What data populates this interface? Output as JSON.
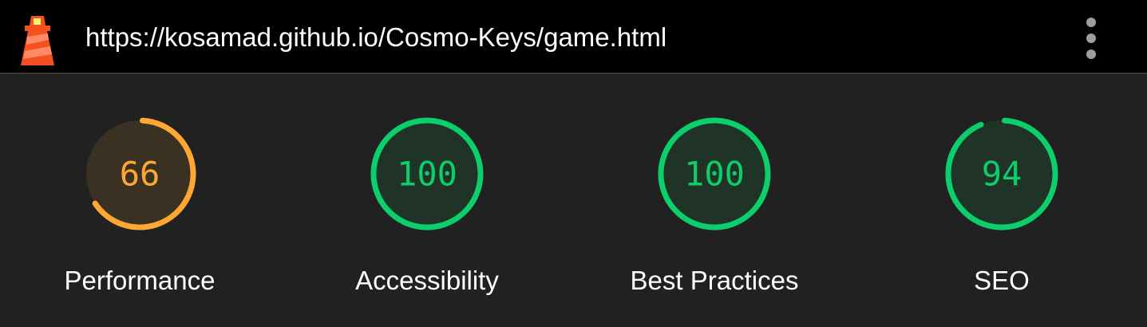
{
  "header": {
    "url": "https://kosamad.github.io/Cosmo-Keys/game.html",
    "logo_icon": "lighthouse-icon",
    "menu_icon": "kebab-menu-icon"
  },
  "scores": [
    {
      "id": "performance",
      "label": "Performance",
      "value": 66,
      "color": "#ffa733",
      "track": "#3a3122"
    },
    {
      "id": "accessibility",
      "label": "Accessibility",
      "value": 100,
      "color": "#0cce6b",
      "track": "#1f3426"
    },
    {
      "id": "best-practices",
      "label": "Best Practices",
      "value": 100,
      "color": "#0cce6b",
      "track": "#1f3426"
    },
    {
      "id": "seo",
      "label": "SEO",
      "value": 94,
      "color": "#0cce6b",
      "track": "#1f3426"
    }
  ]
}
